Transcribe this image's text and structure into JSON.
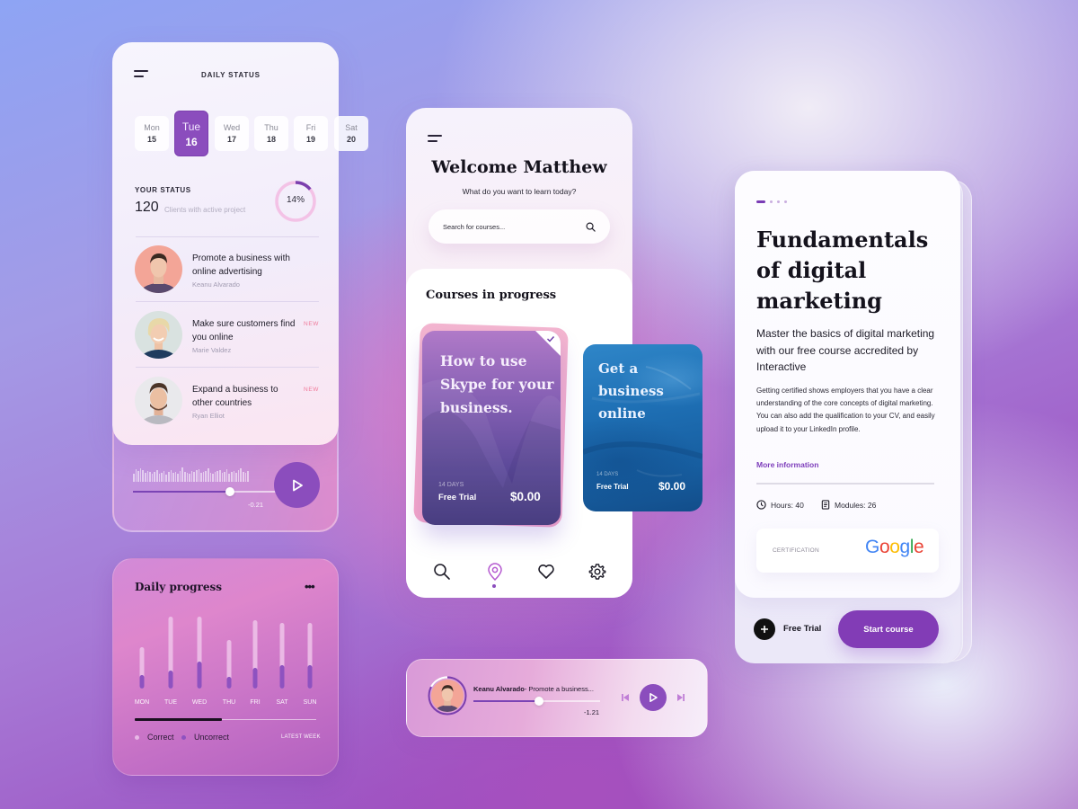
{
  "daily_status": {
    "title": "DAILY STATUS",
    "days": [
      {
        "name": "Mon",
        "num": "15",
        "active": false
      },
      {
        "name": "Tue",
        "num": "16",
        "active": true
      },
      {
        "name": "Wed",
        "num": "17",
        "active": false
      },
      {
        "name": "Thu",
        "num": "18",
        "active": false
      },
      {
        "name": "Fri",
        "num": "19",
        "active": false
      },
      {
        "name": "Sat",
        "num": "20",
        "active": false
      }
    ],
    "status_label": "YOUR STATUS",
    "status_value": "120",
    "status_desc": "Clients with active project",
    "progress_percent": 14,
    "progress_label": "14%",
    "items": [
      {
        "title": "Promote a business with online advertising",
        "name": "Keanu Alvarado",
        "badge": ""
      },
      {
        "title": "Make sure customers find you online",
        "name": "Marie Valdez",
        "badge": "NEW"
      },
      {
        "title": "Expand a business to other countries",
        "name": "Ryan Elliot",
        "badge": "NEW"
      }
    ],
    "audio": {
      "progress": 0.53,
      "time": "-0.21",
      "play_icon": "play-icon"
    }
  },
  "daily_progress": {
    "title": "Daily progress",
    "more_label": "•••",
    "scroll_progress": 0.48,
    "legend": [
      {
        "label": "Correct",
        "color": "#e8b8e6"
      },
      {
        "label": "Uncorrect",
        "color": "#8e52c0"
      }
    ],
    "period_label": "LATEST WEEK"
  },
  "chart_data": {
    "type": "bar",
    "title": "Daily progress",
    "categories": [
      "MON",
      "TUE",
      "WED",
      "THU",
      "FRI",
      "SAT",
      "SUN"
    ],
    "series": [
      {
        "name": "Correct",
        "values": [
          31,
          60,
          50,
          41,
          53,
          47,
          47
        ],
        "color": "#efc4ea"
      },
      {
        "name": "Uncorrect",
        "values": [
          15,
          20,
          30,
          13,
          23,
          26,
          26
        ],
        "color": "#8e52c0"
      }
    ],
    "stacked": true,
    "xlabel": "",
    "ylabel": "",
    "ylim": [
      0,
      80
    ],
    "grid": false,
    "legend_position": "bottom-left"
  },
  "main_app": {
    "welcome": "Welcome Matthew",
    "subtitle": "What do you want to learn today?",
    "search_placeholder": "Search for courses...",
    "courses_title": "Courses in progress",
    "courses": [
      {
        "title": "How to use Skype for your business.",
        "days": "14 DAYS",
        "trial": "Free Trial",
        "price": "$0.00",
        "completed": true
      },
      {
        "title": "Get a business online",
        "days": "14 DAYS",
        "trial": "Free Trial",
        "price": "$0.00",
        "completed": false
      }
    ],
    "nav": [
      {
        "icon": "search-icon",
        "active": false
      },
      {
        "icon": "location-pin-icon",
        "active": true
      },
      {
        "icon": "heart-icon",
        "active": false
      },
      {
        "icon": "gear-icon",
        "active": false
      }
    ]
  },
  "player": {
    "author": "Keanu Alvarado",
    "track": "- Promote a business...",
    "progress": 0.52,
    "time": "-1.21"
  },
  "course_detail": {
    "pager_total": 4,
    "pager_active": 0,
    "title": "Fundamentals of digital marketing",
    "lead": "Master the basics of digital marketing with our free course accredited by Interactive",
    "body": "Getting certified shows employers that you have a clear understanding of the core concepts of digital marketing. You can also add the qualification to your CV, and easily upload it to your LinkedIn profile.",
    "more_link": "More information",
    "hours": "Hours: 40",
    "modules": "Modules: 26",
    "certification_label": "CERTIFICATION",
    "certifier": "Google",
    "free_trial_label": "Free Trial",
    "start_label": "Start course"
  }
}
